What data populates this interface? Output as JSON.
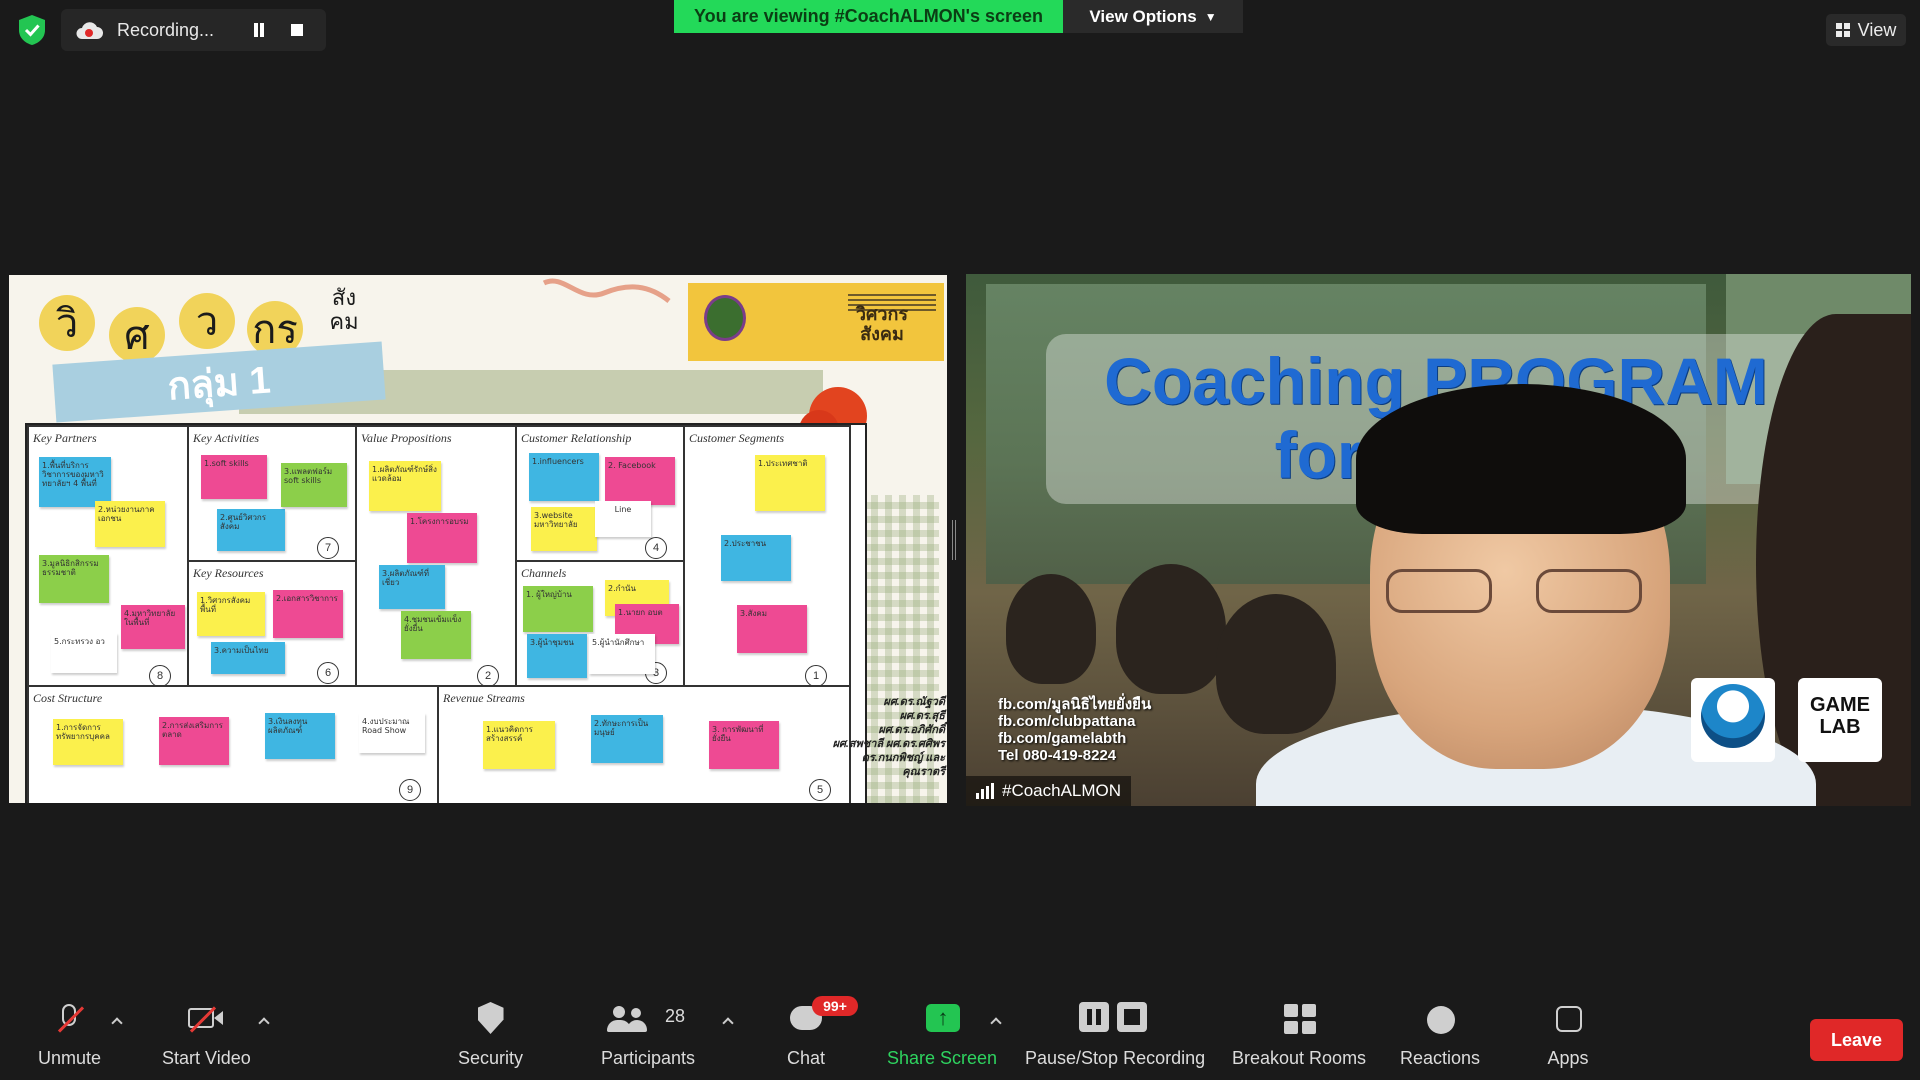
{
  "top_bar": {
    "recording_label": "Recording...",
    "viewing_banner": "You are viewing #CoachALMON's screen",
    "view_options": "View Options",
    "view_label": "View",
    "colors": {
      "banner_green": "#23d959",
      "leave_red": "#e02828"
    }
  },
  "shared_screen": {
    "title_letters": [
      "วิ",
      "ศ",
      "ว",
      "กร",
      "สัง\nคม"
    ],
    "group_label": "กลุ่ม 1",
    "logo_title": "วิศวกร\nสังคม",
    "cells": [
      {
        "title": "Key Partners",
        "number": "8"
      },
      {
        "title": "Key Activities",
        "number": "7"
      },
      {
        "title": "Key Resources",
        "number": "6"
      },
      {
        "title": "Value Propositions",
        "number": "2"
      },
      {
        "title": "Customer Relationship",
        "number": "4"
      },
      {
        "title": "Channels",
        "number": "3"
      },
      {
        "title": "Customer Segments",
        "number": "1"
      },
      {
        "title": "Cost Structure",
        "number": "9"
      },
      {
        "title": "Revenue Streams",
        "number": "5"
      }
    ],
    "notes": {
      "kp1": "1.พื้นที่บริการวิชาการของมหาวิทยาลัยฯ 4 พื้นที่",
      "kp2": "2.หน่วยงานภาคเอกชน",
      "kp3": "3.มูลนิธิกสิกรรมธรรมชาติ",
      "kp4": "4.มหาวิทยาลัยในพื้นที่",
      "kp5": "5.กระทรวง อว",
      "ka1": "1.soft skills",
      "ka2": "2.ศูนย์วิศวกรสังคม",
      "ka3": "3.แพลตฟอร์ม soft skills",
      "kr1": "1.วิศวกรสังคมพื้นที่",
      "kr2": "2.เอกสารวิชาการ",
      "kr3": "3.ความเป็นไทย",
      "vp1": "1.ผลิตภัณฑ์รักษ์สิ่งแวดล้อม",
      "vp2": "1.โครงการอบรม",
      "vp3": "3.ผลิตภัณฑ์ที่เชี่ยว",
      "vp4": "4.ชุมชนเข้มแข็งยั่งยืน",
      "cr1": "1.influencers",
      "cr2": "2. Facebook",
      "cr3": "3.website มหาวิทยาลัย",
      "cr4": "Line",
      "ch1": "1. ผู้ใหญ่บ้าน",
      "ch2": "2.กำนัน",
      "ch3": "1.นายก อบต",
      "ch4": "3.ผู้นำชุมชน",
      "ch5": "5.ผู้นำนักศึกษา",
      "cs1": "1.ประเทศชาติ",
      "cs2": "2.ประชาชน",
      "cs3": "3.สังคม",
      "cost1": "1.การจัดการทรัพยากรบุคคล",
      "cost2": "2.การส่งเสริมการตลาด",
      "cost3": "3.เงินลงทุนผลิตภัณฑ์",
      "cost4": "4.งบประมาณ Road Show",
      "rev1": "1.แนวคิดการสร้างสรรค์",
      "rev2": "2.ทักษะการเป็นมนุษย์",
      "rev3": "3. การพัฒนาที่ยั่งยืน"
    },
    "names": "ผศ.ดร.ณัฐวดี\nผศ.ดร.สุธี\nผศ.ดร.อภิศักดิ์\nผศ.สพชาลี ผศ.ดร.ศศิพร\nดร.กนกพิชญ์ และ\nคุณราตรี"
  },
  "participant": {
    "headline_line1": "Coaching PROGRAM",
    "headline_line2": "for Leader",
    "links": [
      "fb.com/มูลนิธิไทยยั่งยืน",
      "fb.com/clubpattana",
      "fb.com/gamelabth",
      "Tel 080-419-8224"
    ],
    "logo_game": "GAME\nLAB",
    "name": "#CoachALMON"
  },
  "toolbar": {
    "unmute": "Unmute",
    "start_video": "Start Video",
    "security": "Security",
    "participants": "Participants",
    "participants_count": "28",
    "chat": "Chat",
    "chat_badge": "99+",
    "share_screen": "Share Screen",
    "pause_stop_recording": "Pause/Stop Recording",
    "breakout_rooms": "Breakout Rooms",
    "reactions": "Reactions",
    "apps": "Apps",
    "leave": "Leave"
  }
}
